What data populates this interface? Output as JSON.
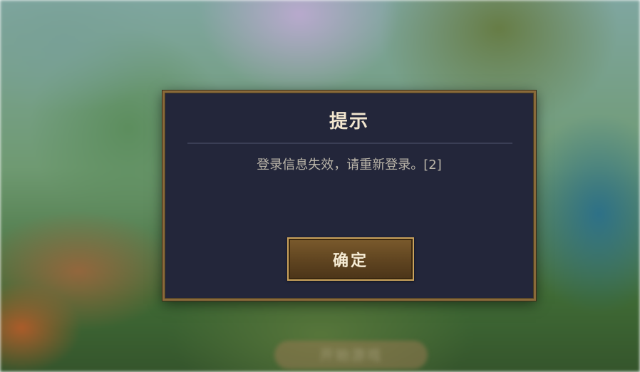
{
  "background": {
    "hidden_button_label": "开始游戏"
  },
  "dialog": {
    "title": "提示",
    "message": "登录信息失效，请重新登录。[2]",
    "confirm_label": "确定"
  },
  "colors": {
    "dialog_bg": "#23263a",
    "dialog_border": "#8a6a3a",
    "button_border": "#c9a25c",
    "title_text": "#f2e6cf",
    "message_text": "#b9b4a8"
  }
}
